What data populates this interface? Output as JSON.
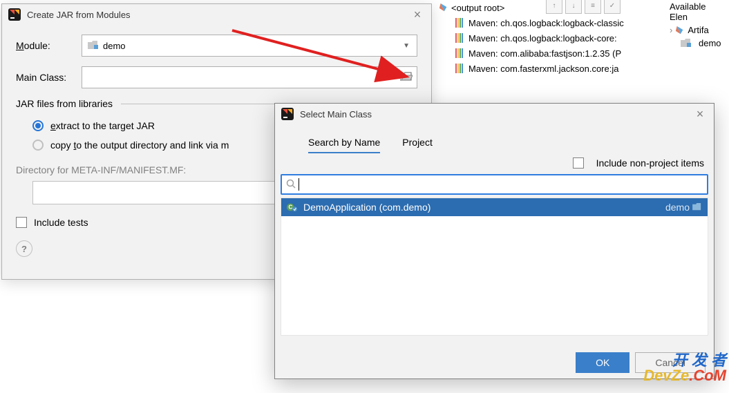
{
  "create_jar": {
    "title": "Create JAR from Modules",
    "module_label": "Module:",
    "module_value": "demo",
    "main_class_label": "Main Class:",
    "main_class_value": "",
    "jar_files_header": "JAR files from libraries",
    "radio_extract": "extract to the target JAR",
    "radio_copy": "copy to the output directory and link via m",
    "directory_label": "Directory for META-INF/MANIFEST.MF:",
    "directory_value": "",
    "include_tests": "Include tests"
  },
  "select_class": {
    "title": "Select Main Class",
    "tab_search": "Search by Name",
    "tab_project": "Project",
    "include_nonproject": "Include non-project items",
    "search_value": "",
    "result": {
      "name": "DemoApplication (com.demo)",
      "module": "demo"
    },
    "ok": "OK",
    "cancel": "Cancel"
  },
  "bg": {
    "output_root": "<output root>",
    "maven_items": [
      "Maven: ch.qos.logback:logback-classic",
      "Maven: ch.qos.logback:logback-core:",
      "Maven: com.alibaba:fastjson:1.2.35 (P",
      "Maven: com.fasterxml.jackson.core:ja"
    ],
    "available": "Available Elen",
    "artifact": "Artifa",
    "demo": "demo"
  },
  "watermark": {
    "top": "开 发 者",
    "bot": "DevZe",
    "bot2": ".CoM"
  }
}
